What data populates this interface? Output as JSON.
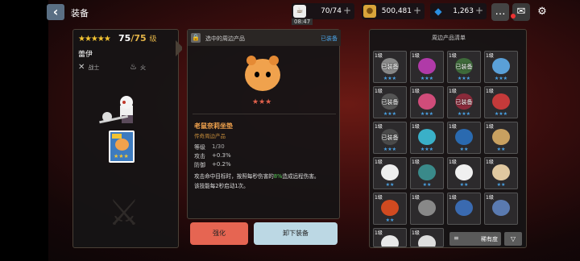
{
  "header": {
    "title": "装备",
    "back_label": "‹"
  },
  "resources": [
    {
      "name": "stamina",
      "icon": "coffee-icon",
      "value": "70/74",
      "sub": "08:47",
      "color": "#f0f0f0"
    },
    {
      "name": "gold",
      "icon": "coin-icon",
      "value": "500,481",
      "color": "#d9a53a"
    },
    {
      "name": "gem",
      "icon": "gem-icon",
      "value": "1,263",
      "color": "#2a8fe0"
    }
  ],
  "character": {
    "stars": "★★★★★",
    "level": "75",
    "level_max": "/75",
    "level_unit": "级",
    "name": "蕾伊",
    "class_label": "战士",
    "element_label": "火"
  },
  "detail": {
    "header_label": "选中的周边产品",
    "equipped_label": "已装备",
    "item_stars": "★★★",
    "item_name": "老鼠奈莉坐垫",
    "item_type": "传奇周边产品",
    "level_label": "等级",
    "level_value": "1/30",
    "atk_label": "攻击",
    "atk_value": "+0.3%",
    "def_label": "防御",
    "def_value": "+0.2%",
    "desc_1": "攻击命中目标时，按照每秒伤害的",
    "desc_hl": "8%",
    "desc_2": "造成远程伤害。",
    "desc_3": "该技能每2秒启动1次。"
  },
  "buttons": {
    "upgrade": "强化",
    "unequip": "卸下装备"
  },
  "list": {
    "title": "周边产品清单",
    "level_tag": "1级",
    "equipped_tag": "已装备",
    "sort_label": "稀有度",
    "items": [
      {
        "art": "#888",
        "eq": true,
        "stars": "★★★"
      },
      {
        "art": "#b03aa8",
        "eq": false,
        "stars": "★★★"
      },
      {
        "art": "#3e6a3a",
        "eq": true,
        "stars": "★★★"
      },
      {
        "art": "#5aa0d8",
        "eq": false,
        "stars": "★★★"
      },
      {
        "art": "#555",
        "eq": true,
        "stars": "★★★"
      },
      {
        "art": "#d04c7a",
        "eq": false,
        "stars": "★★★"
      },
      {
        "art": "#8a2a3a",
        "eq": true,
        "stars": "★★★"
      },
      {
        "art": "#c43a3a",
        "eq": false,
        "stars": "★★★"
      },
      {
        "art": "#4a4a4a",
        "eq": true,
        "stars": "★★★"
      },
      {
        "art": "#3ab0c8",
        "eq": false,
        "stars": "★★★"
      },
      {
        "art": "#2a6ab0",
        "eq": false,
        "stars": "★★"
      },
      {
        "art": "#c8a060",
        "eq": false,
        "stars": "★★"
      },
      {
        "art": "#eee",
        "eq": false,
        "stars": "★★"
      },
      {
        "art": "#3a8a8a",
        "eq": false,
        "stars": "★★"
      },
      {
        "art": "#f0f0f0",
        "eq": false,
        "stars": "★★"
      },
      {
        "art": "#e0c8a0",
        "eq": false,
        "stars": "★★"
      },
      {
        "art": "#d04a20",
        "eq": false,
        "stars": "★★"
      },
      {
        "art": "#888",
        "eq": false,
        "stars": ""
      },
      {
        "art": "#3a6ab0",
        "eq": false,
        "stars": ""
      },
      {
        "art": "#5a7ab0",
        "eq": false,
        "stars": ""
      },
      {
        "art": "#e8e8e8",
        "eq": false,
        "stars": ""
      },
      {
        "art": "#ddd",
        "eq": false,
        "stars": ""
      }
    ]
  }
}
